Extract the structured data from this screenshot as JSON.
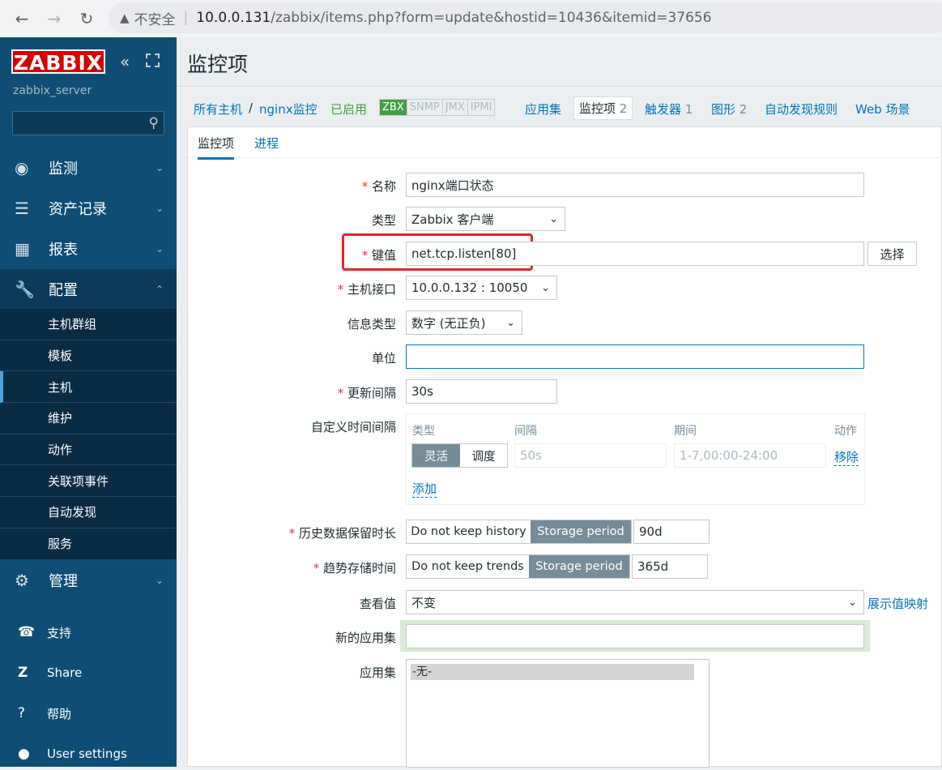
{
  "browser": {
    "insecure_label": "不安全",
    "url_host": "10.0.0.131",
    "url_path": "/zabbix/items.php?form=update&hostid=10436&itemid=37656"
  },
  "sidebar": {
    "logo": "ZABBIX",
    "server_name": "zabbix_server",
    "menu": [
      {
        "label": "监测",
        "icon": "eye-icon"
      },
      {
        "label": "资产记录",
        "icon": "list-icon"
      },
      {
        "label": "报表",
        "icon": "chart-icon"
      },
      {
        "label": "配置",
        "icon": "wrench-icon"
      },
      {
        "label": "管理",
        "icon": "gear-icon"
      }
    ],
    "submenu": [
      "主机群组",
      "模板",
      "主机",
      "维护",
      "动作",
      "关联项事件",
      "自动发现",
      "服务"
    ],
    "bottom": [
      {
        "label": "支持",
        "icon": "headset-icon"
      },
      {
        "label": "Share",
        "icon": "zabbix-share-icon"
      },
      {
        "label": "帮助",
        "icon": "help-icon"
      },
      {
        "label": "User settings",
        "icon": "user-icon"
      }
    ]
  },
  "page": {
    "title": "监控项"
  },
  "hostnav": {
    "all_hosts": "所有主机",
    "sep": "/",
    "host": "nginx监控",
    "enabled": "已启用",
    "tags": [
      "ZBX",
      "SNMP",
      "JMX",
      "IPMI"
    ],
    "apps": "应用集",
    "items": "监控项",
    "items_count": "2",
    "triggers": "触发器",
    "triggers_count": "1",
    "graphs": "图形",
    "graphs_count": "2",
    "discovery": "自动发现规则",
    "web": "Web 场景"
  },
  "tabs": [
    "监控项",
    "进程"
  ],
  "form": {
    "name_label": "名称",
    "name_value": "nginx端口状态",
    "type_label": "类型",
    "type_value": "Zabbix 客户端",
    "key_label": "键值",
    "key_value": "net.tcp.listen[80]",
    "key_button": "选择",
    "iface_label": "主机接口",
    "iface_value": "10.0.0.132 : 10050",
    "info_type_label": "信息类型",
    "info_type_value": "数字 (无正负)",
    "units_label": "单位",
    "units_value": "",
    "interval_label": "更新间隔",
    "interval_value": "30s",
    "custom_label": "自定义时间间隔",
    "custom": {
      "h_type": "类型",
      "h_interval": "间隔",
      "h_period": "期间",
      "h_action": "动作",
      "flexible": "灵活",
      "scheduling": "调度",
      "interval_placeholder": "50s",
      "period_placeholder": "1-7,00:00-24:00",
      "remove": "移除",
      "add": "添加"
    },
    "history_label": "历史数据保留时长",
    "history_off": "Do not keep history",
    "history_on": "Storage period",
    "history_value": "90d",
    "trends_label": "趋势存储时间",
    "trends_off": "Do not keep trends",
    "trends_on": "Storage period",
    "trends_value": "365d",
    "valuemap_label": "查看值",
    "valuemap_value": "不变",
    "valuemap_link": "展示值映射",
    "new_app_label": "新的应用集",
    "new_app_value": "",
    "apps_label": "应用集",
    "apps_option": "-无-"
  }
}
